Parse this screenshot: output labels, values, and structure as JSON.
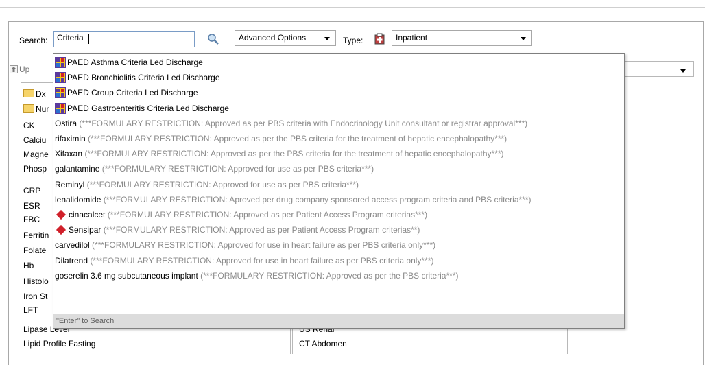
{
  "search": {
    "label": "Search:",
    "value": "Criteria",
    "advanced_options": "Advanced Options",
    "type_label": "Type:",
    "type_value": "Inpatient"
  },
  "toolbar": {
    "up_label": "Up"
  },
  "left_list": {
    "folders": [
      "Dx",
      "Nur"
    ],
    "items": [
      "CK",
      "Calciu",
      "Magne",
      "Phosp",
      "CRP",
      "ESR",
      "FBC",
      "Ferritin",
      "Folate",
      "Hb",
      "Histolo",
      "Iron St",
      "LFT",
      "Lipase Level",
      "Lipid Profile Fasting"
    ]
  },
  "right_list": {
    "items": [
      "US Renal",
      "CT Abdomen"
    ]
  },
  "dropdown": {
    "caresets": [
      "PAED Asthma Criteria Led Discharge",
      "PAED Bronchiolitis Criteria Led Discharge",
      "PAED Croup Criteria Led Discharge",
      "PAED Gastroenteritis Criteria Led Discharge"
    ],
    "orders": [
      {
        "name": "Ostira",
        "note": " (***FORMULARY RESTRICTION: Approved as per PBS criteria with Endocrinology Unit consultant or registrar approval***)"
      },
      {
        "name": "rifaximin",
        "note": " (***FORMULARY RESTRICTION: Approved as per the PBS criteria for the treatment of hepatic encephalopathy***)"
      },
      {
        "name": "Xifaxan",
        "note": " (***FORMULARY RESTRICTION: Approved as per the PBS criteria for the treatment of hepatic encephalopathy***)"
      },
      {
        "name": "galantamine",
        "note": " (***FORMULARY RESTRICTION: Approved for use as per PBS criteria***)"
      },
      {
        "name": "Reminyl",
        "note": " (***FORMULARY RESTRICTION: Approved for use as per PBS criteria***)"
      },
      {
        "name": "lenalidomide",
        "note": " (***FORMULARY RESTRICTION: Aproved per drug company sponsored access program criteria and PBS criteria***)"
      },
      {
        "name": "cinacalcet",
        "note": " (***FORMULARY RESTRICTION: Approved as per Patient Access Program criterias***)",
        "flag": true
      },
      {
        "name": "Sensipar",
        "note": " (***FORMULARY RESTRICTION: Approved as per Patient Access Program criterias**)",
        "flag": true
      },
      {
        "name": "carvedilol",
        "note": " (***FORMULARY RESTRICTION: Approved for use in heart failure as per PBS criteria only***)"
      },
      {
        "name": "Dilatrend",
        "note": " (***FORMULARY RESTRICTION: Approved for use in heart failure as per PBS criteria only***)"
      },
      {
        "name": "goserelin 3.6 mg subcutaneous implant",
        "note": " (***FORMULARY RESTRICTION: Approved as per the PBS criteria***)"
      }
    ],
    "enter_hint": "\"Enter\" to Search"
  },
  "colors": {
    "flag": "#d0202a",
    "note_text": "#8a8a8a",
    "enter_bar": "#dcdcdc"
  },
  "icons": [
    "search-icon",
    "inpatient-type-icon",
    "up-arrow-icon",
    "careset-icon",
    "folder-icon",
    "restriction-diamond-icon"
  ]
}
